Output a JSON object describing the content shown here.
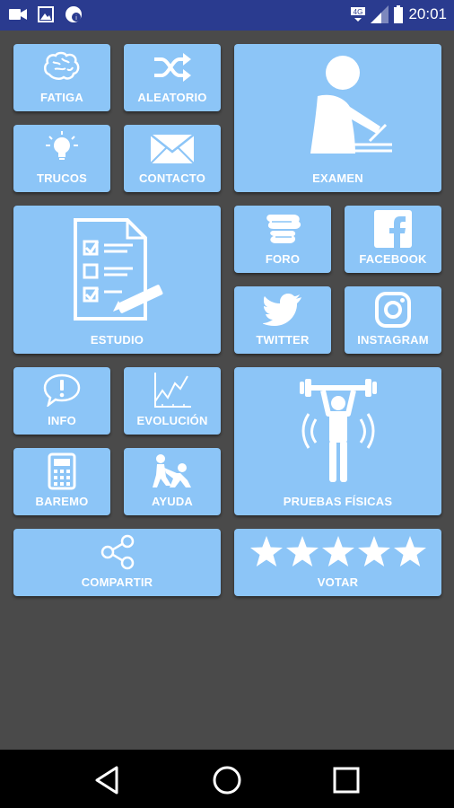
{
  "status_bar": {
    "time": "20:01",
    "network": "4G",
    "icons": [
      "video-icon",
      "image-icon",
      "notification-icon",
      "signal-icon",
      "battery-icon"
    ]
  },
  "tiles": {
    "fatiga": "FATIGA",
    "aleatorio": "ALEATORIO",
    "examen": "EXAMEN",
    "trucos": "TRUCOS",
    "contacto": "CONTACTO",
    "estudio": "ESTUDIO",
    "foro": "FORO",
    "facebook": "FACEBOOK",
    "twitter": "TWITTER",
    "instagram": "INSTAGRAM",
    "info": "INFO",
    "evolucion": "EVOLUCIÓN",
    "pruebas": "PRUEBAS FÍSICAS",
    "baremo": "BAREMO",
    "ayuda": "AYUDA",
    "compartir": "COMPARTIR",
    "votar": "VOTAR"
  },
  "colors": {
    "tile": "#8cc5f7",
    "background": "#4a4a4a",
    "status_bar": "#2a3b8f",
    "nav_bar": "#000000"
  }
}
